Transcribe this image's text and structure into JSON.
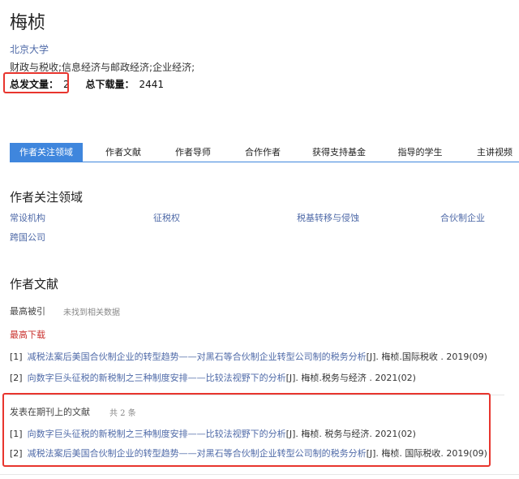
{
  "author": {
    "name": "梅桢",
    "institution": "北京大学",
    "disciplines": "财政与税收;信息经济与邮政经济;企业经济;",
    "stats": {
      "pub_label": "总发文量：",
      "pub_value": "2",
      "download_label": "总下载量：",
      "download_value": "2441"
    }
  },
  "tabs": [
    "作者关注领域",
    "作者文献",
    "作者导师",
    "合作作者",
    "获得支持基金",
    "指导的学生",
    "主讲视频"
  ],
  "focus": {
    "heading": "作者关注领域",
    "keywords": [
      "常设机构",
      "征税权",
      "税基转移与侵蚀",
      "合伙制企业",
      "跨国公司"
    ]
  },
  "literature": {
    "heading": "作者文献",
    "most_cited_label": "最高被引",
    "most_cited_note": "未找到相关数据",
    "most_downloaded_label": "最高下载",
    "downloads": [
      {
        "num": "[1]",
        "title": "减税法案后美国合伙制企业的转型趋势——对黑石等合伙制企业转型公司制的税务分析",
        "meta": "[J]. 梅桢.国际税收 . 2019(09)"
      },
      {
        "num": "[2]",
        "title": "向数字巨头征税的新税制之三种制度安排——比较法视野下的分析",
        "meta": "[J]. 梅桢.税务与经济 . 2021(02)"
      }
    ],
    "journal_label": "发表在期刊上的文献",
    "journal_count": "共 2 条",
    "journal": [
      {
        "num": "[1]",
        "title": "向数字巨头征税的新税制之三种制度安排——比较法视野下的分析",
        "meta": "[J]. 梅桢.  税务与经济. 2021(02)"
      },
      {
        "num": "[2]",
        "title": "减税法案后美国合伙制企业的转型趋势——对黑石等合伙制企业转型公司制的税务分析",
        "meta": "[J]. 梅桢.  国际税收. 2019(09)"
      }
    ]
  },
  "colors": {
    "accent": "#3f86dd",
    "link": "#4f6aa8",
    "highlight": "#e8352e",
    "section_red": "#c9302c"
  }
}
